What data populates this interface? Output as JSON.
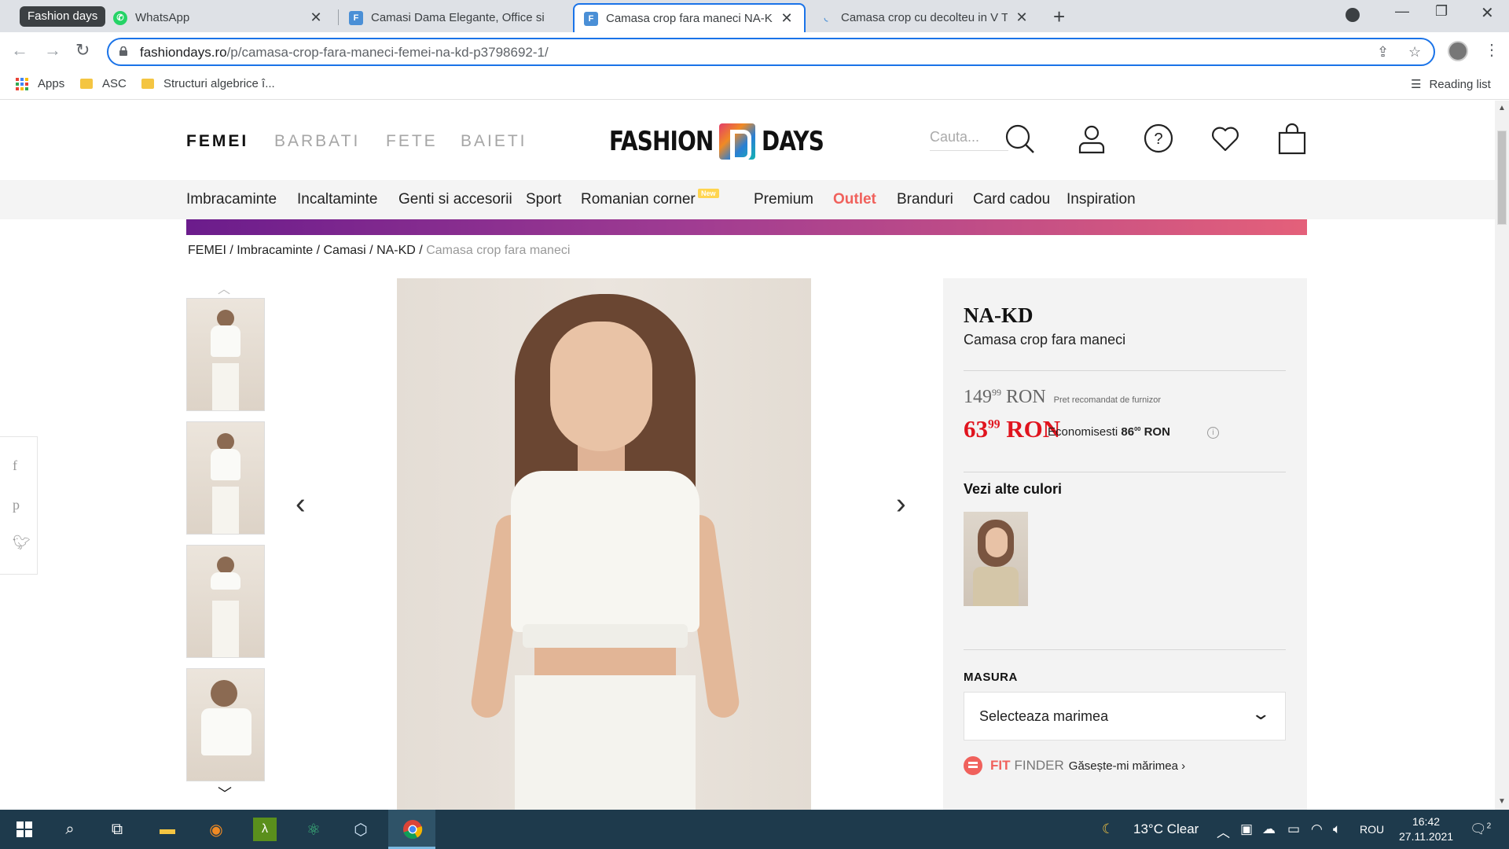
{
  "browser": {
    "tab_group": "Fashion days",
    "tabs": [
      {
        "title": "WhatsApp",
        "active": false
      },
      {
        "title": "Camasi Dama Elegante, Office si",
        "active": false
      },
      {
        "title": "Camasa crop fara maneci NA-KD",
        "active": true
      },
      {
        "title": "Camasa crop cu decolteu in V Tre",
        "active": false
      }
    ],
    "url_domain": "fashiondays.ro",
    "url_path": "/p/camasa-crop-fara-maneci-femei-na-kd-p3798692-1/",
    "bookmarks": [
      "Apps",
      "ASC",
      "Structuri algebrice î..."
    ],
    "reading_list": "Reading list"
  },
  "header": {
    "genders": [
      "FEMEI",
      "BARBATI",
      "FETE",
      "BAIETI"
    ],
    "logo_left": "FASHION",
    "logo_right": "DAYS",
    "search_placeholder": "Cauta..."
  },
  "categories": {
    "items": [
      "Imbracaminte",
      "Incaltaminte",
      "Genti si accesorii",
      "Sport",
      "Romanian corner",
      "Premium",
      "Outlet",
      "Branduri",
      "Card cadou",
      "Inspiration"
    ],
    "new_badge": "New"
  },
  "breadcrumb": {
    "items": [
      "FEMEI",
      "Imbracaminte",
      "Camasi",
      "NA-KD"
    ],
    "current": "Camasa crop fara maneci"
  },
  "product": {
    "brand": "NA-KD",
    "name": "Camasa crop fara maneci",
    "old_price_int": "149",
    "old_price_dec": "99",
    "currency": "RON",
    "recommended_note": "Pret recomandat de furnizor",
    "new_price_int": "63",
    "new_price_dec": "99",
    "savings_label": "Economisesti",
    "savings_int": "86",
    "savings_dec": "00",
    "other_colors_label": "Vezi alte culori",
    "size_label": "MASURA",
    "size_select": "Selecteaza marimea",
    "fit_word1": "FIT",
    "fit_word2": "FINDER",
    "fit_link": "Găsește-mi mărimea ›"
  },
  "taskbar": {
    "weather": "13°C  Clear",
    "lang": "ROU",
    "time": "16:42",
    "date": "27.11.2021",
    "notifications": "2"
  },
  "colors": {
    "accent": "#1a73e8",
    "price_red": "#e0141e",
    "outlet_coral": "#f0615c",
    "taskbar": "#1e3a4c"
  }
}
